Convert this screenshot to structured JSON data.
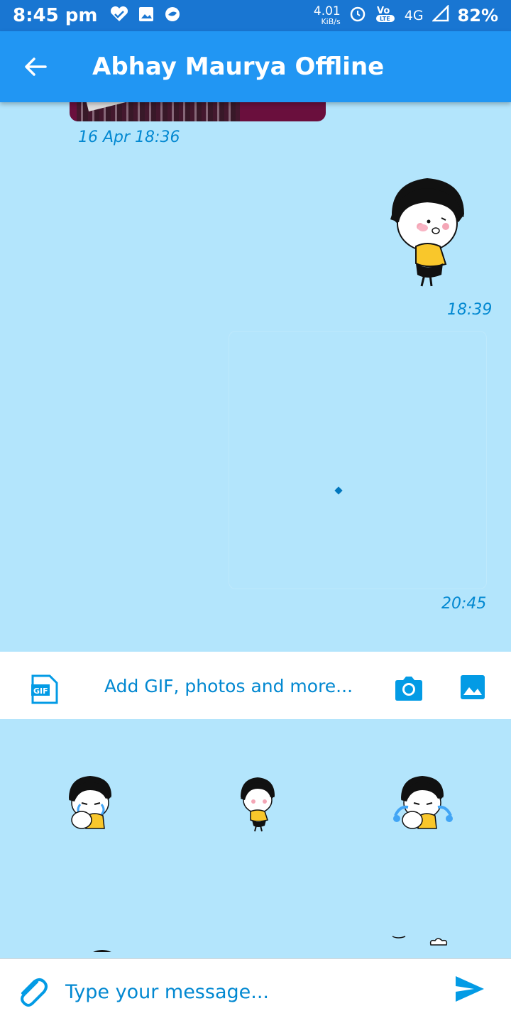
{
  "status_bar": {
    "time": "8:45 pm",
    "net_speed": "4.01",
    "net_unit": "KiB/s",
    "network": "4G",
    "battery": "82%"
  },
  "app_bar": {
    "title": "Abhay Maurya Offline"
  },
  "messages": [
    {
      "type": "image",
      "timestamp": "16 Apr 18:36"
    },
    {
      "type": "sticker",
      "timestamp": "18:39"
    },
    {
      "type": "sticker-loading",
      "timestamp": "20:45"
    }
  ],
  "composer": {
    "add_media_label": "Add GIF, photos and more...",
    "gif_badge": "GIF"
  },
  "input": {
    "placeholder": "Type your message..."
  },
  "colors": {
    "status_bar": "#1976d2",
    "app_bar": "#2196f3",
    "chat_background": "#b3e5fc",
    "accent": "#0288d1"
  }
}
